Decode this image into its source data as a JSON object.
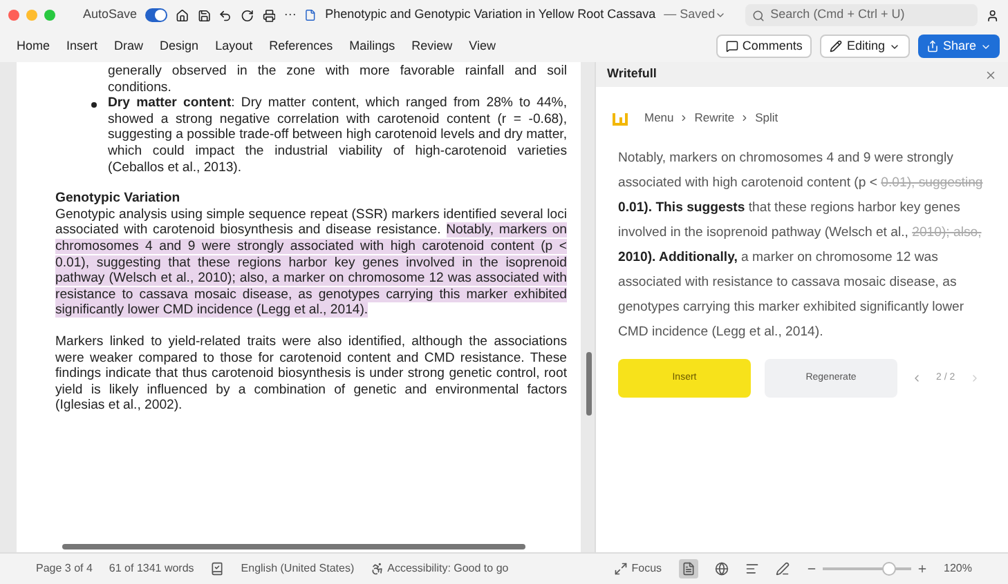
{
  "titlebar": {
    "autosave_label": "AutoSave",
    "autosave_on": true,
    "more": "···",
    "document_title": "Phenotypic and Genotypic Variation in Yellow Root Cassava",
    "saved_status": "— Saved",
    "search_placeholder": "Search (Cmd + Ctrl + U)"
  },
  "ribbon": {
    "tabs": [
      {
        "label": "Home",
        "selected": false
      },
      {
        "label": "Insert",
        "selected": false
      },
      {
        "label": "Draw",
        "selected": false
      },
      {
        "label": "Design",
        "selected": false
      },
      {
        "label": "Layout",
        "selected": false
      },
      {
        "label": "References",
        "selected": false
      },
      {
        "label": "Mailings",
        "selected": false
      },
      {
        "label": "Review",
        "selected": false
      },
      {
        "label": "View",
        "selected": false
      }
    ],
    "comments": "Comments",
    "editing": "Editing",
    "share": "Share"
  },
  "document": {
    "blocks": [
      {
        "kind": "continuation",
        "text": "generally observed in the zone with more favorable rainfall and soil conditions."
      },
      {
        "kind": "bullet",
        "text": "**Dry matter content**: Dry matter content, which ranged from 28% to 44%, showed a strong negative correlation with carotenoid content (r = -0.68), suggesting a possible trade-off between high carotenoid levels and dry matter, which could impact the industrial viability of high-carotenoid varieties (Ceballos et al., 2013)."
      },
      {
        "kind": "heading",
        "text": "Genotypic Variation"
      },
      {
        "kind": "paragraph",
        "text": "Genotypic analysis using simple sequence repeat (SSR) markers identified several loci associated with carotenoid biosynthesis and disease resistance.",
        "highlighted": "Notably, markers on chromosomes 4 and 9 were strongly associated with high carotenoid content (p < 0.01), suggesting that these regions harbor key genes involved in the isoprenoid pathway (Welsch et al., 2010); also, a marker on chromosome 12 was associated with resistance to cassava mosaic disease, as genotypes carrying this marker exhibited significantly lower CMD incidence (Legg et al., 2014)."
      },
      {
        "kind": "paragraph",
        "text": "Markers linked to yield-related traits were also identified, although the associations were weaker compared to those for carotenoid content and CMD resistance. These findings indicate that thus carotenoid biosynthesis is under strong genetic control, root yield is likely influenced by a combination of genetic and environmental factors (Iglesias et al., 2002)."
      }
    ]
  },
  "panel": {
    "title": "Writefull",
    "breadcrumb": [
      "Menu",
      "Rewrite",
      "Split"
    ],
    "suggestion": [
      {
        "kind": "plain",
        "text": "Notably, markers on chromosomes 4 and 9 were strongly associated with high carotenoid content (p <"
      },
      {
        "kind": "deleted",
        "text": "0.01), suggesting"
      },
      {
        "kind": "added",
        "text": "0.01). This suggests"
      },
      {
        "kind": "plain",
        "text": "that these regions harbor key genes involved in the isoprenoid pathway (Welsch et al.,"
      },
      {
        "kind": "deleted",
        "text": "2010); also,"
      },
      {
        "kind": "added",
        "text": "2010). Additionally,"
      },
      {
        "kind": "plain",
        "text": "a marker on chromosome 12 was associated with resistance to cassava mosaic disease, as genotypes carrying this marker exhibited significantly lower CMD incidence (Legg et al., 2014)."
      }
    ],
    "insert": "Insert",
    "regenerate": "Regenerate",
    "pager": "2 / 2"
  },
  "status_bar": {
    "page": "Page 3 of 4",
    "words": "61 of 1341 words",
    "language": "English (United States)",
    "accessibility": "Accessibility: Good to go",
    "focus": "Focus",
    "level": 0.75,
    "zoom": "120%"
  }
}
